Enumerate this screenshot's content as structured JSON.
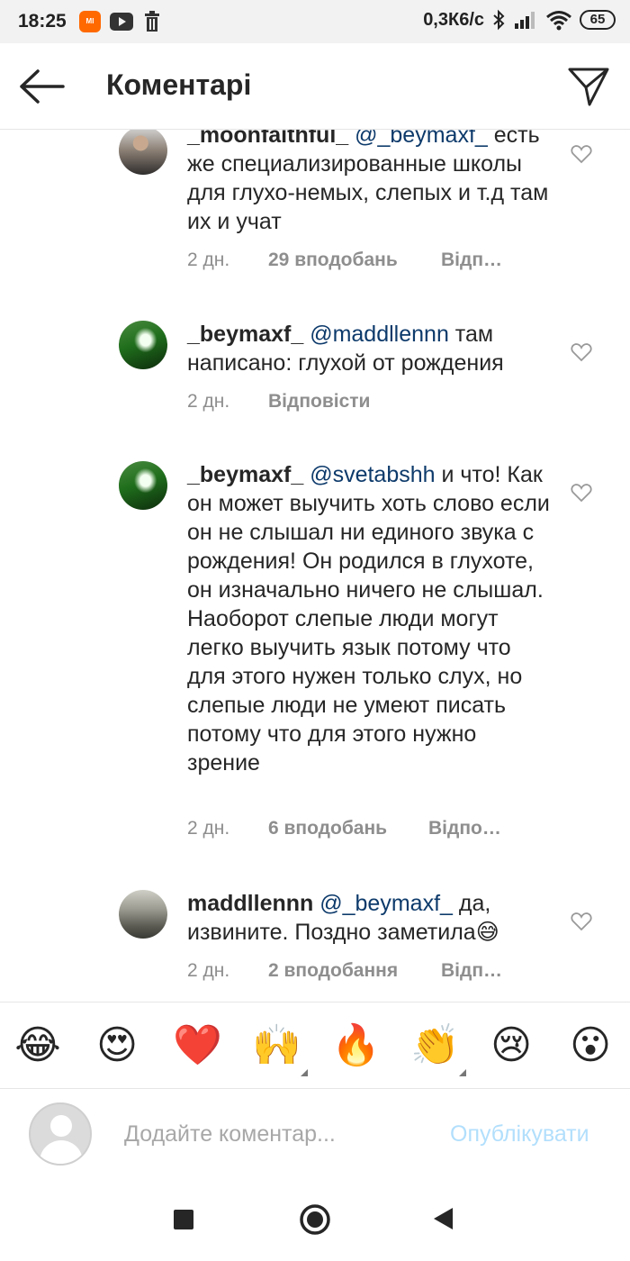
{
  "status_bar": {
    "time": "18:25",
    "mi_badge": "MI",
    "network_speed": "0,3К6/с",
    "battery": "65",
    "icons": [
      "xiaomi-icon",
      "youtube-icon",
      "trash-icon",
      "bluetooth-icon",
      "signal-icon",
      "wifi-icon",
      "battery-icon"
    ]
  },
  "header": {
    "title": "Коментарі",
    "back_icon": "arrow-left-icon",
    "share_icon": "paper-plane-icon"
  },
  "comments": [
    {
      "username": "_moonfaithful_",
      "mention": "@_beymaxf_",
      "text": "есть же специализированные школы для глухо-немых, слепых и т.д там их и учат",
      "time": "2 дн.",
      "likes": "29 вподобань",
      "reply": "Відповісти"
    },
    {
      "username": "_beymaxf_",
      "mention": "@maddllennn",
      "text": "там написано: глухой от рождения",
      "time": "2 дн.",
      "likes": "",
      "reply": "Відповісти"
    },
    {
      "username": "_beymaxf_",
      "mention": "@svetabshh",
      "text": "и что! Как он может выучить хоть слово если он не слышал ни единого звука с рождения! Он родился в глухоте, он изначально ничего не слышал. Наоборот слепые люди могут легко выучить язык потому что для этого нужен только слух, но слепые люди не умеют писать потому что для этого нужно зрение",
      "time": "2 дн.",
      "likes": "6 вподобань",
      "reply": "Відповісти"
    },
    {
      "username": "maddllennn",
      "mention": "@_beymaxf_",
      "text": "да, извините. Поздно заметила😅",
      "time": "2 дн.",
      "likes": "2 вподобання",
      "reply": "Відповісти"
    }
  ],
  "emoji_bar": {
    "emojis": [
      "😂",
      "😍",
      "❤️",
      "🙌",
      "🔥",
      "👏",
      "😢",
      "😮"
    ]
  },
  "input_bar": {
    "placeholder": "Додайте коментар...",
    "publish_label": "Опублікувати"
  },
  "nav_bar": {
    "icons": [
      "recent-apps-icon",
      "home-icon",
      "back-icon"
    ]
  },
  "colors": {
    "mention": "#0d3a6b",
    "meta_text": "#8e8e8e",
    "publish_disabled": "#b2dffc",
    "status_bar_bg": "#f2f2f2",
    "mi_orange": "#ff6900"
  }
}
